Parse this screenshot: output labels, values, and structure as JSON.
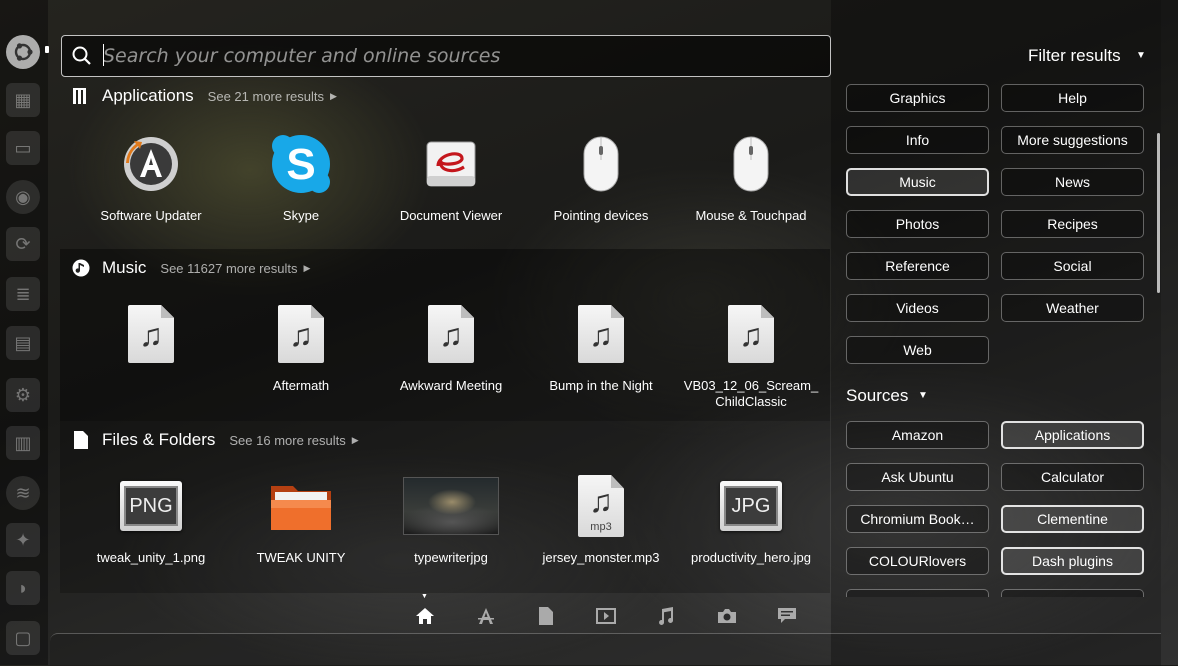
{
  "search": {
    "placeholder": "Search your computer and online sources",
    "value": ""
  },
  "categories": [
    {
      "title": "Applications",
      "more": "See 21 more results",
      "items": [
        {
          "label": "Software Updater",
          "icon": "software-updater-icon"
        },
        {
          "label": "Skype",
          "icon": "skype-icon"
        },
        {
          "label": "Document Viewer",
          "icon": "document-viewer-icon"
        },
        {
          "label": "Pointing devices",
          "icon": "mouse-icon"
        },
        {
          "label": "Mouse & Touchpad",
          "icon": "mouse-icon"
        }
      ]
    },
    {
      "title": "Music",
      "more": "See 11627 more results",
      "items": [
        {
          "label": "",
          "icon": "music-file-icon"
        },
        {
          "label": "Aftermath",
          "icon": "music-file-icon"
        },
        {
          "label": "Awkward Meeting",
          "icon": "music-file-icon"
        },
        {
          "label": "Bump in the Night",
          "icon": "music-file-icon"
        },
        {
          "label": "VB03_12_06_Scream_\nChildClassic",
          "icon": "music-file-icon"
        }
      ]
    },
    {
      "title": "Files & Folders",
      "more": "See 16 more results",
      "items": [
        {
          "label": "tweak_unity_1.png",
          "icon": "png-file-icon",
          "badge": "PNG"
        },
        {
          "label": "TWEAK UNITY",
          "icon": "folder-icon"
        },
        {
          "label": "typewriterjpg",
          "icon": "image-thumbnail"
        },
        {
          "label": "jersey_monster.mp3",
          "icon": "mp3-file-icon",
          "badge": "mp3"
        },
        {
          "label": "productivity_hero.jpg",
          "icon": "jpg-file-icon",
          "badge": "JPG"
        }
      ]
    }
  ],
  "filter": {
    "title": "Filter results",
    "categories": [
      {
        "label": "Graphics",
        "active": false
      },
      {
        "label": "Help",
        "active": false
      },
      {
        "label": "Info",
        "active": false
      },
      {
        "label": "More suggestions",
        "active": false
      },
      {
        "label": "Music",
        "active": true
      },
      {
        "label": "News",
        "active": false
      },
      {
        "label": "Photos",
        "active": false
      },
      {
        "label": "Recipes",
        "active": false
      },
      {
        "label": "Reference",
        "active": false
      },
      {
        "label": "Social",
        "active": false
      },
      {
        "label": "Videos",
        "active": false
      },
      {
        "label": "Weather",
        "active": false
      },
      {
        "label": "Web",
        "active": false
      }
    ],
    "sources_title": "Sources",
    "sources": [
      {
        "label": "Amazon",
        "active": false
      },
      {
        "label": "Applications",
        "active": true
      },
      {
        "label": "Ask Ubuntu",
        "active": false
      },
      {
        "label": "Calculator",
        "active": false
      },
      {
        "label": "Chromium Book…",
        "active": false
      },
      {
        "label": "Clementine",
        "active": true
      },
      {
        "label": "COLOURlovers",
        "active": false
      },
      {
        "label": "Dash plugins",
        "active": true
      }
    ]
  },
  "lenses": [
    {
      "name": "home-lens",
      "icon": "home-icon",
      "active": true
    },
    {
      "name": "applications-lens",
      "icon": "applications-icon",
      "active": false
    },
    {
      "name": "files-lens",
      "icon": "file-icon",
      "active": false
    },
    {
      "name": "video-lens",
      "icon": "video-icon",
      "active": false
    },
    {
      "name": "music-lens",
      "icon": "music-icon",
      "active": false
    },
    {
      "name": "photos-lens",
      "icon": "camera-icon",
      "active": false
    },
    {
      "name": "social-lens",
      "icon": "speech-bubble-icon",
      "active": false
    }
  ],
  "launcher": {
    "items": [
      "ubuntu-logo-icon",
      "workspace-switcher-icon",
      "files-icon",
      "chromium-icon",
      "update-icon",
      "writer-icon",
      "calc-icon",
      "settings-icon",
      "library-icon",
      "spotify-icon",
      "network-icon",
      "shell-icon",
      "monitor-icon"
    ]
  }
}
